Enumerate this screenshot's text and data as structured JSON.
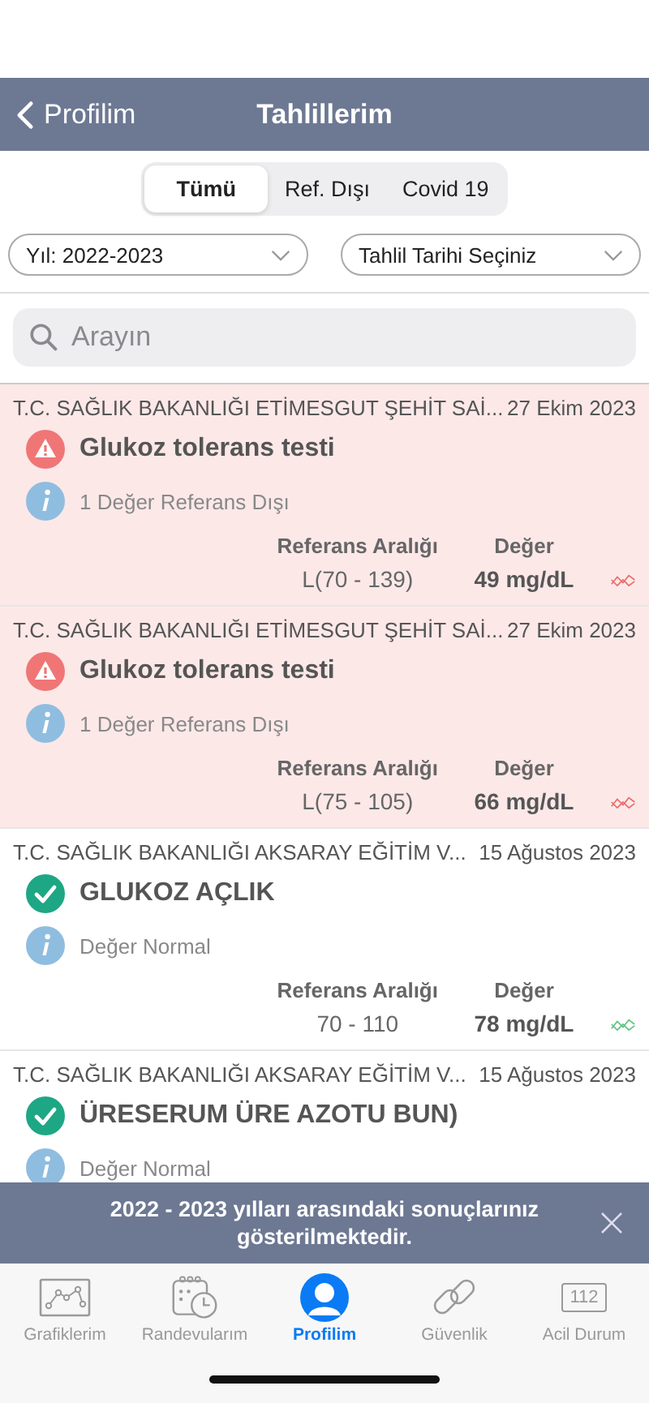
{
  "nav": {
    "back": "Profilim",
    "title": "Tahlillerim"
  },
  "segments": [
    {
      "label": "Tümü",
      "selected": true
    },
    {
      "label": "Ref. Dışı",
      "selected": false
    },
    {
      "label": "Covid 19",
      "selected": false
    }
  ],
  "filters": [
    "Yıl: 2022-2023",
    "Tahlil Tarihi Seçiniz"
  ],
  "search": {
    "placeholder": "Arayın"
  },
  "results": [
    {
      "lab": "T.C. SAĞLIK BAKANLIĞI ETİMESGUT ŞEHİT SAİ...",
      "date": "27 Ekim 2023",
      "name": "Glukoz tolerans testi",
      "kind": "out",
      "note": "1 Değer Referans Dışı",
      "range_label": "Referans Aralığı",
      "value_label": "Değer",
      "range": "L(70 - 139)",
      "value": "49 mg/dL"
    },
    {
      "lab": "T.C. SAĞLIK BAKANLIĞI ETİMESGUT ŞEHİT SAİ...",
      "date": "27 Ekim 2023",
      "name": "Glukoz tolerans testi",
      "kind": "out",
      "note": "1 Değer Referans Dışı",
      "range_label": "Referans Aralığı",
      "value_label": "Değer",
      "range": "L(75 - 105)",
      "value": "66 mg/dL"
    },
    {
      "lab": "T.C. SAĞLIK BAKANLIĞI AKSARAY EĞİTİM V...",
      "date": "15 Ağustos 2023",
      "name": "GLUKOZ AÇLIK",
      "kind": "normal",
      "note": "Değer Normal",
      "range_label": "Referans Aralığı",
      "value_label": "Değer",
      "range": "70 - 110",
      "value": "78 mg/dL"
    },
    {
      "lab": "T.C. SAĞLIK BAKANLIĞI AKSARAY EĞİTİM V...",
      "date": "15 Ağustos 2023",
      "name": "ÜRESERUM ÜRE AZOTU BUN)",
      "kind": "normal",
      "note": "Değer Normal"
    }
  ],
  "banner": {
    "text": "2022 - 2023 yılları arasındaki sonuçlarınız gösterilmektedir."
  },
  "tabbar": [
    {
      "kind": "chart",
      "label": "Grafiklerim",
      "selected": false
    },
    {
      "kind": "calendar",
      "label": "Randevularım",
      "selected": false
    },
    {
      "kind": "profile",
      "label": "Profilim",
      "selected": true
    },
    {
      "kind": "link",
      "label": "Güvenlik",
      "selected": false
    },
    {
      "kind": "emergency",
      "label": "Acil Durum",
      "selected": false,
      "icon_text": "112"
    }
  ]
}
